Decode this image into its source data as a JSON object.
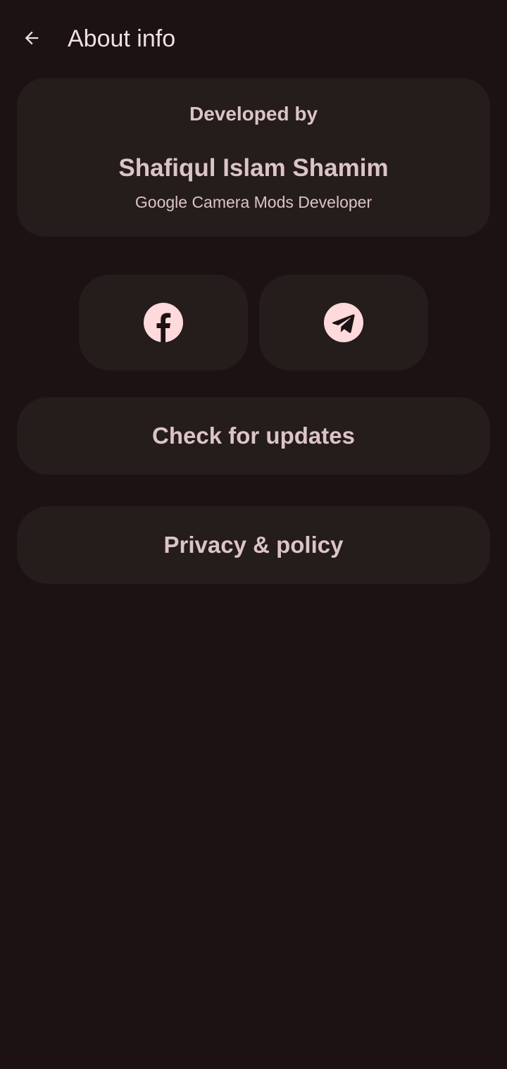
{
  "header": {
    "title": "About info",
    "back_icon": "arrow-back-icon"
  },
  "developer_card": {
    "label": "Developed by",
    "name": "Shafiqul Islam Shamim",
    "role": "Google Camera Mods Developer"
  },
  "social": {
    "facebook_icon": "facebook-icon",
    "telegram_icon": "telegram-icon"
  },
  "actions": {
    "check_updates_label": "Check for updates",
    "privacy_label": "Privacy & policy"
  },
  "colors": {
    "background": "#1c1213",
    "surface": "#251c1c",
    "text": "#dcc4c6",
    "icon_bg": "#ffdadc"
  }
}
